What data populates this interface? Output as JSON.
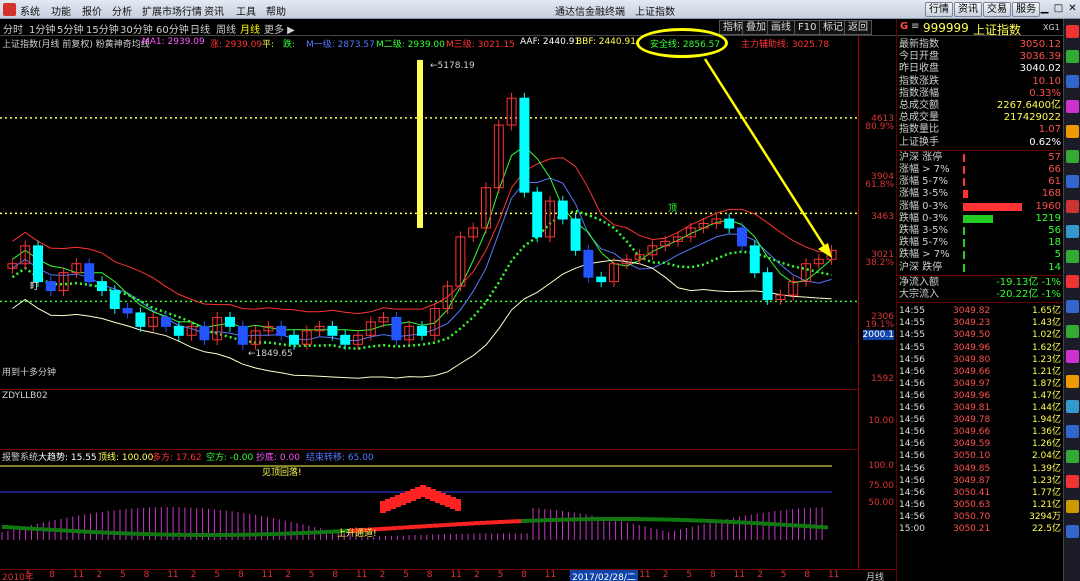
{
  "window": {
    "title": "通达信金融终端　上证指数",
    "menu": [
      "系统",
      "功能",
      "报价",
      "分析",
      "扩展市场行情",
      "资讯",
      "工具",
      "帮助"
    ],
    "buttons": [
      "行情",
      "资讯",
      "交易",
      "服务"
    ]
  },
  "toolbar": {
    "periods": [
      {
        "label": "分时",
        "active": false
      },
      {
        "label": "1分钟",
        "active": false
      },
      {
        "label": "5分钟",
        "active": false
      },
      {
        "label": "15分钟",
        "active": false
      },
      {
        "label": "30分钟",
        "active": false
      },
      {
        "label": "60分钟",
        "active": false
      },
      {
        "label": "日线",
        "active": false
      },
      {
        "label": "周线",
        "active": false
      },
      {
        "label": "月线",
        "active": true
      },
      {
        "label": "更多",
        "active": false
      }
    ],
    "tools": [
      "指标",
      "叠加",
      "画线",
      "F10",
      "标记",
      "返回"
    ]
  },
  "indicator_line": {
    "name": "上证指数(月线 前复权) 粉黄神奇均线",
    "items": [
      {
        "label": "MA1: 2939.09",
        "color": "#ff55ff"
      },
      {
        "label": "涨: 2939.09",
        "color": "#ff3333"
      },
      {
        "label": "平: ",
        "color": "#ffff55"
      },
      {
        "label": "跌: ",
        "color": "#33ff33"
      },
      {
        "label": "M一级: 2873.57",
        "color": "#5577ff"
      },
      {
        "label": "M二级: 2939.00",
        "color": "#33ff33"
      },
      {
        "label": "M三级: 3021.15",
        "color": "#ff3333"
      },
      {
        "label": "AAF: 2440.91",
        "color": "#ffffff"
      },
      {
        "label": "BBF: 2440.91",
        "color": "#ffff55"
      },
      {
        "label": "安全线: 2856.57",
        "color": "#33ff33"
      },
      {
        "label": "主力辅助线: 3025.78",
        "color": "#ff3333"
      }
    ]
  },
  "main_chart": {
    "y_ticks": [
      "4613",
      "80.9%",
      "3904",
      "61.8%",
      "3463",
      "3021",
      "38.2%",
      "2306",
      "19.1%",
      "2000.1",
      "1592"
    ],
    "annotations": {
      "high": "5178.19",
      "low": "1849.65",
      "bottom_note": "用到十多分钟",
      "mid_note": "盯",
      "top_note": "顶"
    }
  },
  "sub_chart1": {
    "name": "ZDYLLB02",
    "tick": "10.00"
  },
  "sub_chart2": {
    "header": [
      {
        "label": "报警系统",
        "color": "#cfcfcf"
      },
      {
        "label": "大趋势: 15.55",
        "color": "#ffffff"
      },
      {
        "label": "顶线: 100.00",
        "color": "#ffff55"
      },
      {
        "label": "多方: 17.62",
        "color": "#ff3333"
      },
      {
        "label": "空方: -0.00",
        "color": "#33ff33"
      },
      {
        "label": "抄底: 0.00",
        "color": "#ff55ff"
      },
      {
        "label": "结束转移: 65.00",
        "color": "#5577ff"
      }
    ],
    "y_ticks": [
      "100.0",
      "75.00",
      "50.00"
    ],
    "notes": {
      "top": "见顶回落!",
      "bottom": "上升通道!"
    }
  },
  "x_axis": {
    "labels": [
      "2010年",
      "5",
      "8",
      "11",
      "2",
      "5",
      "8",
      "11",
      "2",
      "5",
      "8",
      "11",
      "2",
      "5",
      "8",
      "11",
      "2",
      "5",
      "8",
      "11",
      "2",
      "5",
      "8",
      "11",
      "2",
      "5",
      "8",
      "11",
      "2",
      "5",
      "8",
      "11",
      "2",
      "5",
      "8",
      "11"
    ],
    "highlight": "2017/02/28/二",
    "period": "月线"
  },
  "quote": {
    "code": "999999",
    "name": "上证指数",
    "tag": "XG1",
    "rows": [
      {
        "label": "最新指数",
        "value": "3050.12",
        "color": "#ff4f4f"
      },
      {
        "label": "今日开盘",
        "value": "3036.39",
        "color": "#ff4f4f"
      },
      {
        "label": "昨日收盘",
        "value": "3040.02",
        "color": "#ffffff"
      },
      {
        "label": "指数涨跌",
        "value": "10.10",
        "color": "#ff4f4f"
      },
      {
        "label": "指数涨幅",
        "value": "0.33%",
        "color": "#ff4f4f"
      },
      {
        "label": "总成交额",
        "value": "2267.6400亿",
        "color": "#ffff55"
      },
      {
        "label": "总成交量",
        "value": "217429022",
        "color": "#ffff55"
      },
      {
        "label": "指数量比",
        "value": "1.07",
        "color": "#ff4f4f"
      },
      {
        "label": "上证换手",
        "value": "0.62%",
        "color": "#ffffff"
      }
    ],
    "breadth": [
      {
        "label": "沪深 涨停",
        "value": "57",
        "bar": 0.02,
        "color": "#ff3333"
      },
      {
        "label": "涨幅 > 7%",
        "value": "66",
        "bar": 0.03,
        "color": "#ff3333"
      },
      {
        "label": "涨幅 5-7%",
        "value": "61",
        "bar": 0.03,
        "color": "#ff3333"
      },
      {
        "label": "涨幅 3-5%",
        "value": "168",
        "bar": 0.07,
        "color": "#ff3333"
      },
      {
        "label": "涨幅 0-3%",
        "value": "1960",
        "bar": 0.9,
        "color": "#ff3333"
      },
      {
        "label": "跌幅 0-3%",
        "value": "1219",
        "bar": 0.45,
        "color": "#22cc22"
      },
      {
        "label": "跌幅 3-5%",
        "value": "56",
        "bar": 0.02,
        "color": "#22cc22"
      },
      {
        "label": "跌幅 5-7%",
        "value": "18",
        "bar": 0.01,
        "color": "#22cc22"
      },
      {
        "label": "跌幅 > 7%",
        "value": "5",
        "bar": 0.005,
        "color": "#22cc22"
      },
      {
        "label": "沪深 跌停",
        "value": "14",
        "bar": 0.01,
        "color": "#22cc22"
      }
    ],
    "flows": [
      {
        "label": "净流入额",
        "value": "-19.13亿 -1%"
      },
      {
        "label": "大宗流入",
        "value": "-20.22亿 -1%"
      }
    ],
    "ticks": [
      {
        "t": "14:55",
        "p": "3049.82",
        "v": "1.65亿"
      },
      {
        "t": "14:55",
        "p": "3049.23",
        "v": "1.43亿"
      },
      {
        "t": "14:55",
        "p": "3049.50",
        "v": "1.02亿"
      },
      {
        "t": "14:55",
        "p": "3049.96",
        "v": "1.62亿"
      },
      {
        "t": "14:56",
        "p": "3049.80",
        "v": "1.23亿"
      },
      {
        "t": "14:56",
        "p": "3049.66",
        "v": "1.21亿"
      },
      {
        "t": "14:56",
        "p": "3049.97",
        "v": "1.87亿"
      },
      {
        "t": "14:56",
        "p": "3049.96",
        "v": "1.47亿"
      },
      {
        "t": "14:56",
        "p": "3049.81",
        "v": "1.44亿"
      },
      {
        "t": "14:56",
        "p": "3049.78",
        "v": "1.94亿"
      },
      {
        "t": "14:56",
        "p": "3049.66",
        "v": "1.36亿"
      },
      {
        "t": "14:56",
        "p": "3049.59",
        "v": "1.26亿"
      },
      {
        "t": "14:56",
        "p": "3050.10",
        "v": "2.04亿"
      },
      {
        "t": "14:56",
        "p": "3049.85",
        "v": "1.39亿"
      },
      {
        "t": "14:56",
        "p": "3049.87",
        "v": "1.23亿"
      },
      {
        "t": "14:56",
        "p": "3050.41",
        "v": "1.77亿"
      },
      {
        "t": "14:56",
        "p": "3050.63",
        "v": "1.21亿"
      },
      {
        "t": "14:56",
        "p": "3050.70",
        "v": "3294万"
      },
      {
        "t": "15:00",
        "p": "3050.21",
        "v": "22.5亿"
      }
    ]
  },
  "sidebar": {
    "icons": [
      "1-icon",
      "2-icon",
      "3-icon",
      "4-icon",
      "5-icon",
      "6-icon",
      "7-icon",
      "8-icon",
      "9-icon",
      "10-icon",
      "11-icon",
      "12-icon",
      "13-icon",
      "14-icon",
      "15-icon",
      "16-icon",
      "17-icon",
      "18-icon",
      "19-icon",
      "20-icon",
      "21-icon"
    ]
  },
  "chart_data": {
    "type": "candlestick",
    "title": "上证指数(月线 前复权)",
    "xlabel": "",
    "ylabel": "",
    "ylim": [
      1592,
      5178.19
    ],
    "series": [
      {
        "name": "上证指数 月K",
        "ohlc_close_approx": [
          2900,
          3100,
          2700,
          2600,
          2800,
          2900,
          2700,
          2600,
          2400,
          2350,
          2200,
          2300,
          2200,
          2100,
          2200,
          2050,
          2300,
          2200,
          2000,
          2150,
          2200,
          2100,
          2000,
          2150,
          2200,
          2100,
          2000,
          2100,
          2250,
          2300,
          2050,
          2200,
          2100,
          2400,
          2650,
          3200,
          3300,
          3750,
          4450,
          4750,
          3700,
          3200,
          3600,
          3400,
          3050,
          2750,
          2700,
          2900,
          2950,
          3000,
          3100,
          3150,
          3200,
          3300,
          3350,
          3400,
          3300,
          3100,
          2800,
          2500,
          2550,
          2700,
          2900,
          2950,
          3050
        ]
      },
      {
        "name": "M一级",
        "values": [
          2873.57
        ]
      },
      {
        "name": "M二级",
        "values": [
          2939.0
        ]
      },
      {
        "name": "M三级",
        "values": [
          3021.15
        ]
      },
      {
        "name": "安全线",
        "values": [
          2856.57
        ]
      },
      {
        "name": "主力辅助线",
        "values": [
          3025.78
        ]
      }
    ]
  }
}
